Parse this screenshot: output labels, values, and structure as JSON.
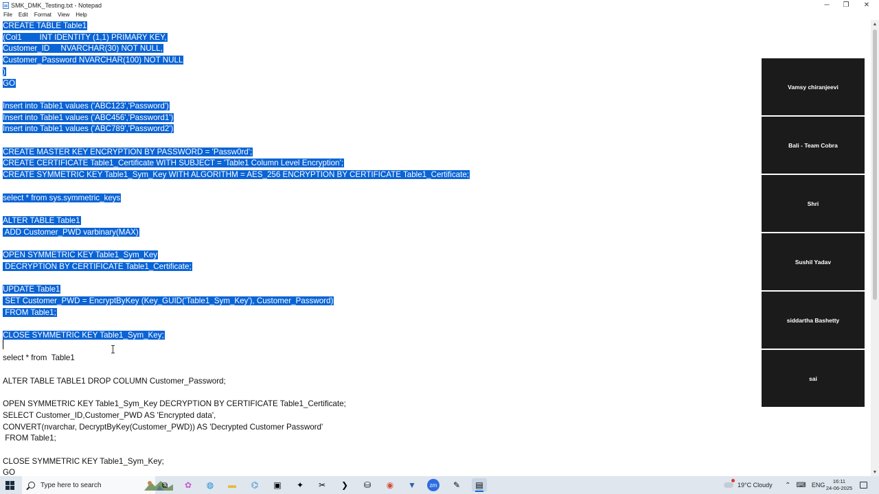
{
  "window": {
    "title": "SMK_DMK_Testing.txt - Notepad",
    "controls": {
      "minimize": "─",
      "maximize": "❐",
      "close": "✕"
    }
  },
  "menu": [
    "File",
    "Edit",
    "Format",
    "View",
    "Help"
  ],
  "editor": {
    "lines": [
      {
        "text": "CREATE TABLE Table1",
        "selected": true
      },
      {
        "text": "(Col1        INT IDENTITY (1,1) PRIMARY KEY,",
        "selected": true
      },
      {
        "text": "Customer_ID     NVARCHAR(30) NOT NULL,",
        "selected": true
      },
      {
        "text": "Customer_Password NVARCHAR(100) NOT NULL",
        "selected": true
      },
      {
        "text": ")",
        "selected": true
      },
      {
        "text": "GO",
        "selected": true
      },
      {
        "text": "",
        "selected": false
      },
      {
        "text": "Insert into Table1 values ('ABC123','Password')",
        "selected": true
      },
      {
        "text": "Insert into Table1 values ('ABC456','Password1')",
        "selected": true
      },
      {
        "text": "Insert into Table1 values ('ABC789','Password2')",
        "selected": true
      },
      {
        "text": "",
        "selected": false
      },
      {
        "text": "CREATE MASTER KEY ENCRYPTION BY PASSWORD = 'Passw0rd';",
        "selected": true
      },
      {
        "text": "CREATE CERTIFICATE Table1_Certificate WITH SUBJECT = 'Table1 Column Level Encryption';",
        "selected": true
      },
      {
        "text": "CREATE SYMMETRIC KEY Table1_Sym_Key WITH ALGORITHM = AES_256 ENCRYPTION BY CERTIFICATE Table1_Certificate;",
        "selected": true
      },
      {
        "text": "",
        "selected": false
      },
      {
        "text": "select * from sys.symmetric_keys",
        "selected": true
      },
      {
        "text": "",
        "selected": false
      },
      {
        "text": "ALTER TABLE Table1",
        "selected": true
      },
      {
        "text": " ADD Customer_PWD varbinary(MAX)",
        "selected": true
      },
      {
        "text": "",
        "selected": false
      },
      {
        "text": "OPEN SYMMETRIC KEY Table1_Sym_Key",
        "selected": true
      },
      {
        "text": " DECRYPTION BY CERTIFICATE Table1_Certificate;",
        "selected": true
      },
      {
        "text": "",
        "selected": false
      },
      {
        "text": "UPDATE Table1",
        "selected": true
      },
      {
        "text": " SET Customer_PWD = EncryptByKey (Key_GUID('Table1_Sym_Key'), Customer_Password)",
        "selected": true
      },
      {
        "text": " FROM Table1;",
        "selected": true
      },
      {
        "text": "",
        "selected": false
      },
      {
        "text": "CLOSE SYMMETRIC KEY Table1_Sym_Key;",
        "selected": true
      },
      {
        "text": "",
        "selected": false
      },
      {
        "text": "select * from  Table1",
        "selected": false
      },
      {
        "text": "",
        "selected": false
      },
      {
        "text": "ALTER TABLE TABLE1 DROP COLUMN Customer_Password;",
        "selected": false
      },
      {
        "text": "",
        "selected": false
      },
      {
        "text": "OPEN SYMMETRIC KEY Table1_Sym_Key DECRYPTION BY CERTIFICATE Table1_Certificate;",
        "selected": false
      },
      {
        "text": "SELECT Customer_ID,Customer_PWD AS 'Encrypted data',",
        "selected": false
      },
      {
        "text": "CONVERT(nvarchar, DecryptByKey(Customer_PWD)) AS 'Decrypted Customer Password'",
        "selected": false
      },
      {
        "text": " FROM Table1;",
        "selected": false
      },
      {
        "text": "",
        "selected": false
      },
      {
        "text": "CLOSE SYMMETRIC KEY Table1_Sym_Key;",
        "selected": false
      },
      {
        "text": "GO",
        "selected": false
      }
    ]
  },
  "participants": [
    "Vamsy chiranjeevi",
    "Bali - Team Cobra",
    "Shri",
    "Sushil Yadav",
    "siddartha Bashetty",
    "sai"
  ],
  "taskbar": {
    "search_placeholder": "Type here to search",
    "apps": [
      {
        "icon": "task-view-icon",
        "glyph": "⧉",
        "active": false
      },
      {
        "icon": "copilot-icon",
        "glyph": "✿",
        "active": false
      },
      {
        "icon": "edge-icon",
        "glyph": "◍",
        "active": false
      },
      {
        "icon": "file-explorer-icon",
        "glyph": "▬",
        "active": false
      },
      {
        "icon": "vscode-icon",
        "glyph": "⌬",
        "active": false
      },
      {
        "icon": "remote-desktop-icon",
        "glyph": "▣",
        "active": false
      },
      {
        "icon": "dev-tool-icon",
        "glyph": "✦",
        "active": false
      },
      {
        "icon": "snipping-tool-icon",
        "glyph": "✂",
        "active": false
      },
      {
        "icon": "powershell-icon",
        "glyph": "❯",
        "active": false
      },
      {
        "icon": "sql-tool-icon",
        "glyph": "⛁",
        "active": false
      },
      {
        "icon": "chrome-icon",
        "glyph": "◉",
        "active": false
      },
      {
        "icon": "ssms-icon",
        "glyph": "▼",
        "active": false
      },
      {
        "icon": "zoom-icon",
        "glyph": "zm",
        "active": false
      },
      {
        "icon": "notepad-icon",
        "glyph": "✎",
        "active": false
      },
      {
        "icon": "notepad-active-icon",
        "glyph": "▤",
        "active": true
      }
    ],
    "weather": "19°C  Cloudy",
    "language": "ENG",
    "time": "16:11",
    "date": "24-06-2025"
  },
  "colors": {
    "selection": "#0a64d6",
    "taskbar": "#dfe6ee",
    "tile_bg": "#1b1b1b"
  }
}
